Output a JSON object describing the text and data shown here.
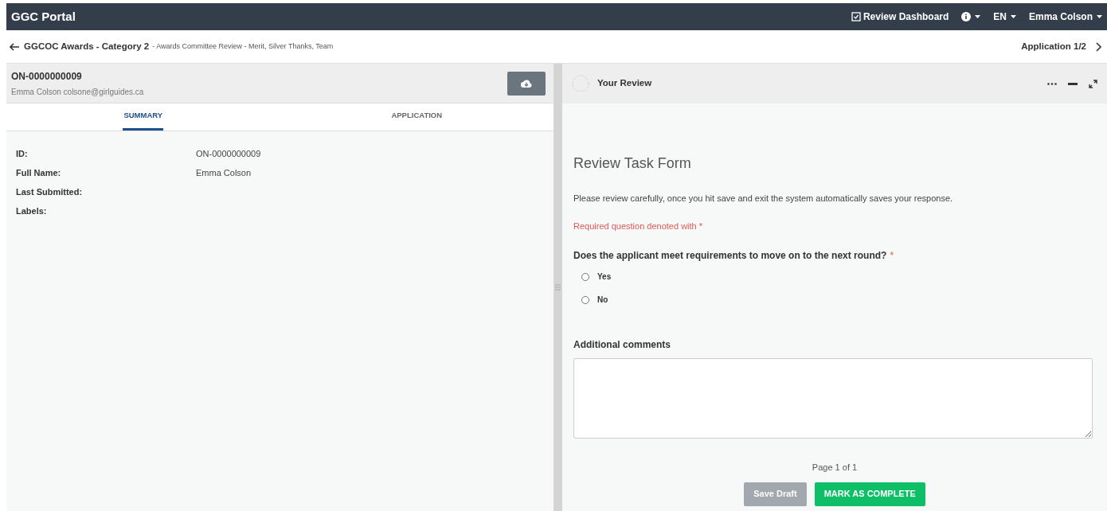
{
  "navbar": {
    "title": "GGC Portal",
    "dashboard": "Review Dashboard",
    "language": "EN",
    "user": "Emma Colson"
  },
  "breadcrumb": {
    "title": "GGCOC Awards - Category 2",
    "subtitle": "- Awards Committee Review - Merit, Silver Thanks, Team",
    "position": "Application 1/2"
  },
  "applicant": {
    "id": "ON-0000000009",
    "name": "Emma Colson colsone@girlguides.ca"
  },
  "tabs": [
    {
      "label": "SUMMARY",
      "selected": true
    },
    {
      "label": "APPLICATION",
      "selected": false
    }
  ],
  "summary": [
    {
      "label": "ID:",
      "value": "ON-0000000009"
    },
    {
      "label": "Full Name:",
      "value": "Emma Colson"
    },
    {
      "label": "Last Submitted:"
    },
    {
      "label": "Labels:"
    }
  ],
  "review": {
    "title": "Your Review",
    "form_title": "Review Task Form",
    "intro": "Please review carefully, once you hit save and exit the system automatically saves your response.",
    "required_note": "Required question denoted with *",
    "question": "Does the applicant meet requirements to move on to the next round?",
    "required_mark": "*",
    "options": [
      {
        "label": "Yes",
        "selected": false
      },
      {
        "label": "No",
        "selected": false
      }
    ],
    "comments_label": "Additional comments",
    "pager": "Page 1 of 1",
    "buttons": [
      {
        "label": "Save Draft",
        "kind": "secondary",
        "disabled": true
      },
      {
        "label": "MARK AS COMPLETE",
        "kind": "primary",
        "disabled": false
      }
    ]
  }
}
